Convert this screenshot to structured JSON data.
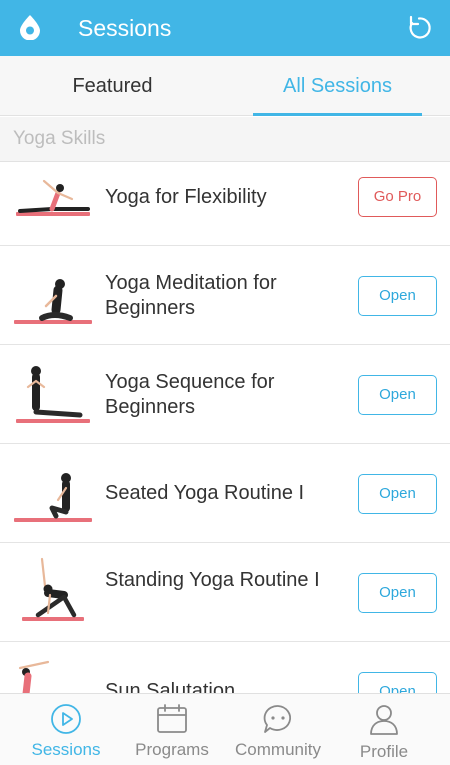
{
  "appbar": {
    "title": "Sessions",
    "icons": [
      "app-logo-icon",
      "refresh-icon"
    ]
  },
  "tabs": [
    {
      "label": "Featured",
      "active": false
    },
    {
      "label": "All Sessions",
      "active": true
    }
  ],
  "section": {
    "title": "Yoga Skills"
  },
  "sessions": [
    {
      "title": "Yoga for Flexibility",
      "action": "Go Pro",
      "locked": true
    },
    {
      "title": "Yoga Meditation for Beginners",
      "action": "Open",
      "locked": false
    },
    {
      "title": "Yoga Sequence for Beginners",
      "action": "Open",
      "locked": false
    },
    {
      "title": "Seated Yoga Routine I",
      "action": "Open",
      "locked": false
    },
    {
      "title": "Standing Yoga Routine I",
      "action": "Open",
      "locked": false
    },
    {
      "title": "Sun Salutation",
      "action": "Open",
      "locked": false
    }
  ],
  "bottom_nav": [
    {
      "label": "Sessions",
      "icon": "play-circle-icon",
      "active": true
    },
    {
      "label": "Programs",
      "icon": "calendar-icon",
      "active": false
    },
    {
      "label": "Community",
      "icon": "chat-bubble-icon",
      "active": false
    },
    {
      "label": "Profile",
      "icon": "person-icon",
      "active": false
    }
  ],
  "colors": {
    "accent": "#41b6e6",
    "pro": "#e05a5a",
    "mat": "#e8707a"
  }
}
